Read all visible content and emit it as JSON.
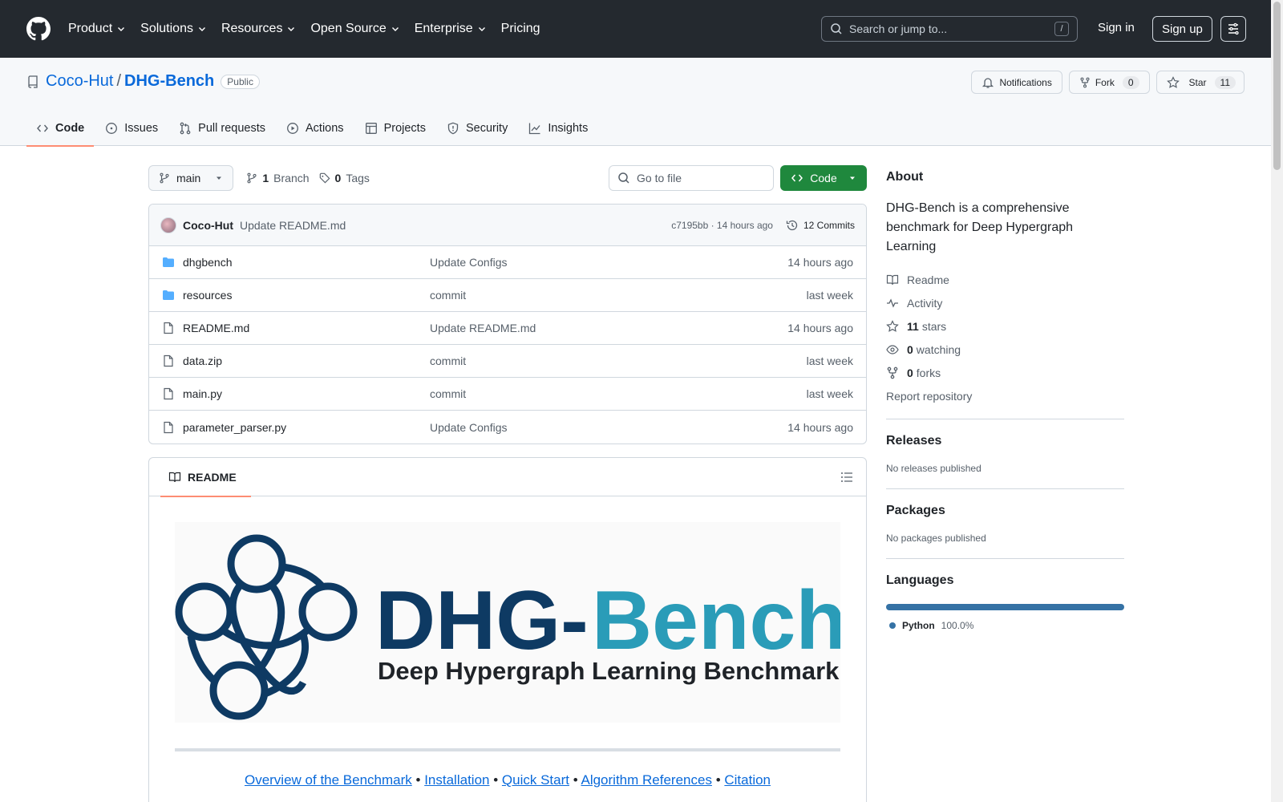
{
  "header": {
    "nav": [
      "Product",
      "Solutions",
      "Resources",
      "Open Source",
      "Enterprise",
      "Pricing"
    ],
    "search_placeholder": "Search or jump to...",
    "search_shortcut": "/",
    "signin": "Sign in",
    "signup": "Sign up"
  },
  "repo": {
    "owner": "Coco-Hut",
    "separator": "/",
    "name": "DHG-Bench",
    "visibility": "Public",
    "notifications_label": "Notifications",
    "fork_label": "Fork",
    "fork_count": "0",
    "star_label": "Star",
    "star_count": "11",
    "tabs": [
      "Code",
      "Issues",
      "Pull requests",
      "Actions",
      "Projects",
      "Security",
      "Insights"
    ]
  },
  "toolbar": {
    "branch": "main",
    "branch_count": "1",
    "branch_label": "Branch",
    "tag_count": "0",
    "tag_label": "Tags",
    "goto_placeholder": "Go to file",
    "code_button": "Code"
  },
  "commit": {
    "author": "Coco-Hut",
    "message": "Update README.md",
    "sha_time": "c7195bb · 14 hours ago",
    "commits_label": "12 Commits"
  },
  "files": [
    {
      "name": "dhgbench",
      "type": "dir",
      "message": "Update Configs",
      "time": "14 hours ago"
    },
    {
      "name": "resources",
      "type": "dir",
      "message": "commit",
      "time": "last week"
    },
    {
      "name": "README.md",
      "type": "file",
      "message": "Update README.md",
      "time": "14 hours ago"
    },
    {
      "name": "data.zip",
      "type": "file",
      "message": "commit",
      "time": "last week"
    },
    {
      "name": "main.py",
      "type": "file",
      "message": "commit",
      "time": "last week"
    },
    {
      "name": "parameter_parser.py",
      "type": "file",
      "message": "Update Configs",
      "time": "14 hours ago"
    }
  ],
  "readme": {
    "tab_label": "README",
    "banner_dhg": "DHG-",
    "banner_bench": "Bench",
    "banner_subtitle": "Deep Hypergraph Learning Benchmark",
    "links": [
      "Overview of the Benchmark",
      "Installation",
      "Quick Start",
      "Algorithm References",
      "Citation"
    ],
    "link_separator": "•"
  },
  "sidebar": {
    "about_title": "About",
    "description": "DHG-Bench is a comprehensive benchmark for Deep Hypergraph Learning",
    "readme": "Readme",
    "activity": "Activity",
    "stars_count": "11",
    "stars_label": "stars",
    "watching_count": "0",
    "watching_label": "watching",
    "forks_count": "0",
    "forks_label": "forks",
    "report": "Report repository",
    "releases_title": "Releases",
    "releases_text": "No releases published",
    "packages_title": "Packages",
    "packages_text": "No packages published",
    "languages_title": "Languages",
    "language_name": "Python",
    "language_percent": "100.0%"
  },
  "colors": {
    "header_bg": "#24292f",
    "link": "#0969da",
    "code_button": "#1f883d",
    "tab_underline": "#fd8c73",
    "python": "#3572A5",
    "banner_navy": "#0e3a63",
    "banner_teal": "#2a9cb8"
  }
}
